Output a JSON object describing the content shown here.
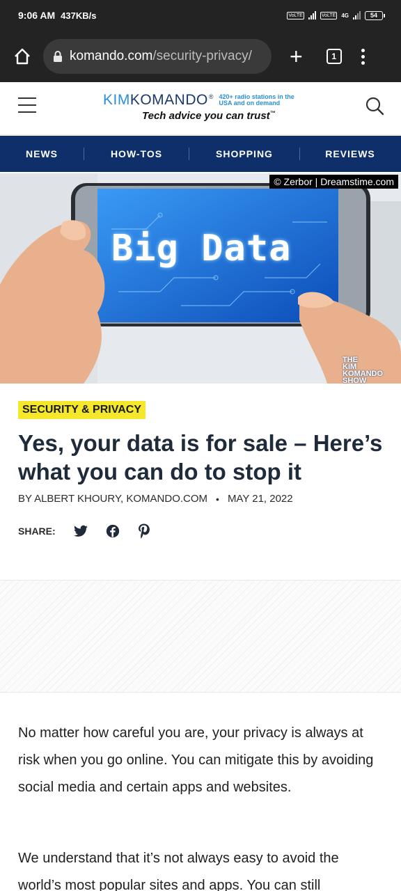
{
  "status": {
    "time": "9:06 AM",
    "speed": "437KB/s",
    "battery": "54",
    "network": "4G",
    "volte": "VoLTE"
  },
  "browser": {
    "domain": "komando.com",
    "path": "/security-privacy/",
    "tab_count": "1"
  },
  "header": {
    "logo_kim": "KIM",
    "logo_komando": "KOMANDO",
    "logo_reg": "®",
    "logo_radio": "420+ radio stations in the USA and on demand",
    "tagline": "Tech advice you can trust",
    "tagline_tm": "™"
  },
  "nav": {
    "items": [
      "NEWS",
      "HOW-TOS",
      "SHOPPING",
      "REVIEWS"
    ]
  },
  "hero": {
    "credit": "© Zerbor | Dreamstime.com",
    "image_text": "Big Data",
    "show_logo": [
      "THE",
      "KIM",
      "KOMANDO",
      "SHOW"
    ]
  },
  "article": {
    "category": "SECURITY & PRIVACY",
    "headline": "Yes, your data is for sale – Here’s what you can do to stop it",
    "byline": "BY ALBERT KHOURY, KOMANDO.COM",
    "separator": "•",
    "date": "MAY 21, 2022",
    "share_label": "SHARE:",
    "paragraphs": [
      "No matter how careful you are, your privacy is always at risk when you go online. You can mitigate this by avoiding social media and certain apps and websites.",
      "We understand that it’s not always easy to avoid the world’s most popular sites and apps. You can still"
    ]
  },
  "colors": {
    "nav_bg": "#0f2f6b",
    "badge_bg": "#f5e82a",
    "logo_blue": "#2a8fd6",
    "logo_navy": "#1a3a6b"
  }
}
